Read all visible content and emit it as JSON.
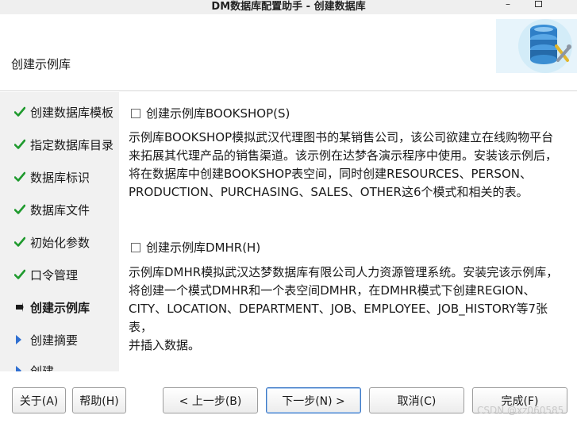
{
  "window": {
    "title": "DM数据库配置助手 - 创建数据库"
  },
  "header": {
    "subtitle": "创建示例库",
    "logo_icon": "database-tools-icon"
  },
  "sidebar": {
    "steps": [
      {
        "label": "创建数据库模板",
        "status": "done"
      },
      {
        "label": "指定数据库目录",
        "status": "done"
      },
      {
        "label": "数据库标识",
        "status": "done"
      },
      {
        "label": "数据库文件",
        "status": "done"
      },
      {
        "label": "初始化参数",
        "status": "done"
      },
      {
        "label": "口令管理",
        "status": "done"
      },
      {
        "label": "创建示例库",
        "status": "current"
      },
      {
        "label": "创建摘要",
        "status": "pending"
      },
      {
        "label": "创建",
        "status": "pending"
      }
    ]
  },
  "bookshop": {
    "checkbox_label": "创建示例库BOOKSHOP(S)",
    "checked": false,
    "description_lines": [
      "示例库BOOKSHOP模拟武汉代理图书的某销售公司，该公司欲建立在线购物平台",
      "来拓展其代理产品的销售渠道。该示例在达梦各演示程序中使用。安装该示例后，",
      "将在数据库中创建BOOKSHOP表空间，同时创建RESOURCES、PERSON、",
      "PRODUCTION、PURCHASING、SALES、OTHER这6个模式和相关的表。"
    ]
  },
  "dmhr": {
    "checkbox_label": "创建示例库DMHR(H)",
    "checked": false,
    "description_lines": [
      "示例库DMHR模拟武汉达梦数据库有限公司人力资源管理系统。安装完该示例库，",
      "将创建一个模式DMHR和一个表空间DMHR，在DMHR模式下创建REGION、",
      "CITY、LOCATION、DEPARTMENT、JOB、EMPLOYEE、JOB_HISTORY等7张表，",
      "并插入数据。"
    ]
  },
  "buttons": {
    "about": "关于(A)",
    "help": "帮助(H)",
    "back": "< 上一步(B)",
    "next": "下一步(N) >",
    "cancel": "取消(C)",
    "finish": "完成(F)"
  },
  "watermark": "CSDN @xz060585",
  "colors": {
    "check": "#1f9a2e",
    "arrow": "#2f6fd1",
    "sidebar_bg": "#f1f1f1"
  }
}
